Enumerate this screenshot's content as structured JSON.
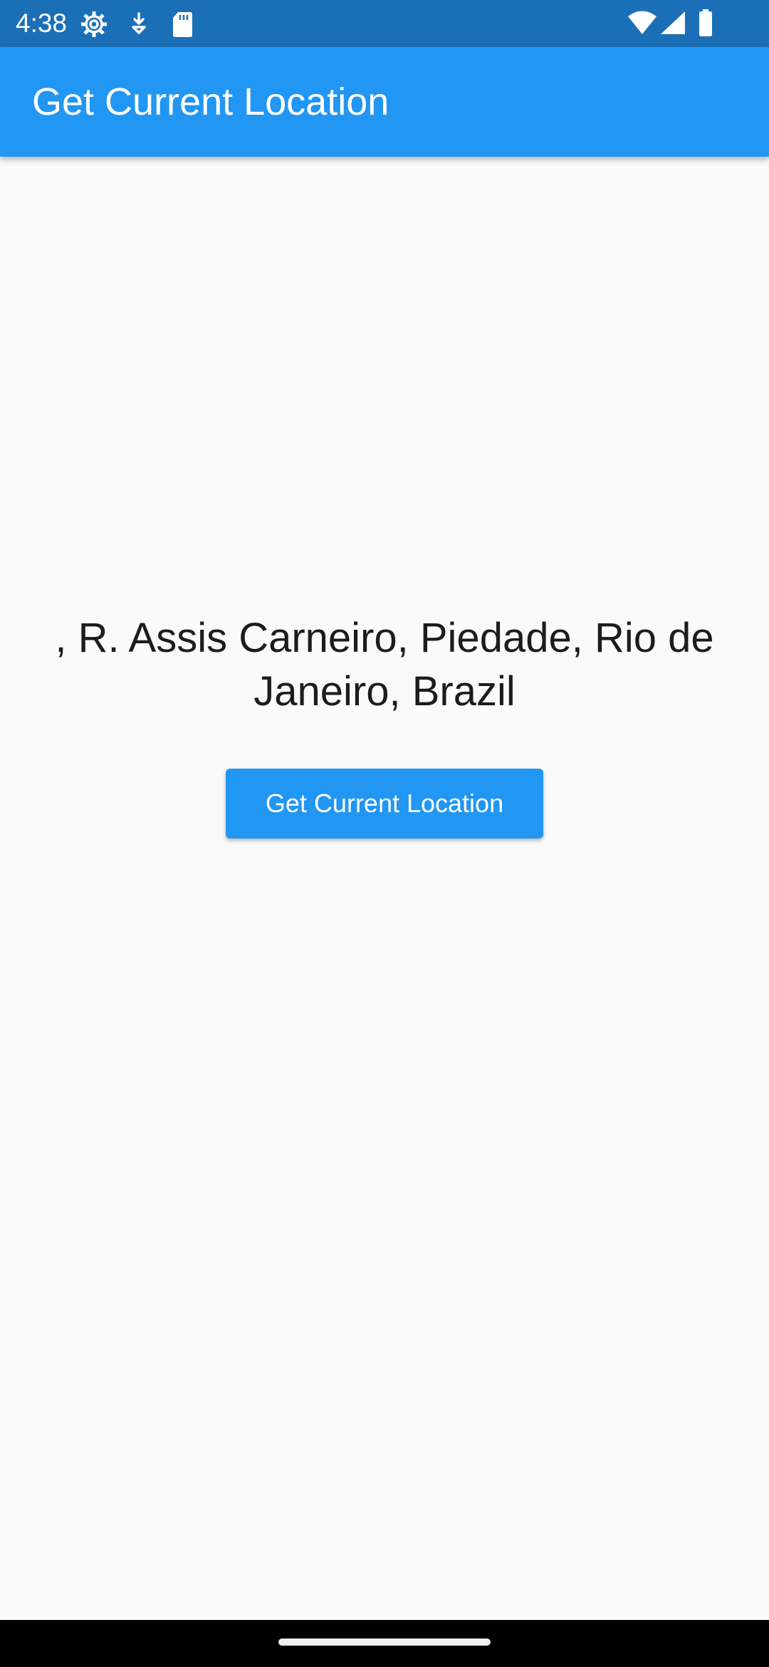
{
  "status_bar": {
    "time": "4:38",
    "left_icons": [
      "settings-gear-icon",
      "download-notification-icon",
      "sd-card-icon"
    ],
    "right_icons": [
      "wifi-icon",
      "cellular-signal-icon",
      "battery-icon"
    ],
    "background_color": "#1b6fb7"
  },
  "app_bar": {
    "title": "Get Current Location",
    "background_color": "#2196f3"
  },
  "main": {
    "address": ", R. Assis Carneiro, Piedade, Rio de Janeiro, Brazil",
    "button_label": "Get Current Location",
    "background_color": "#fafafa"
  },
  "navigation_bar": {
    "indicator": "home-indicator"
  }
}
